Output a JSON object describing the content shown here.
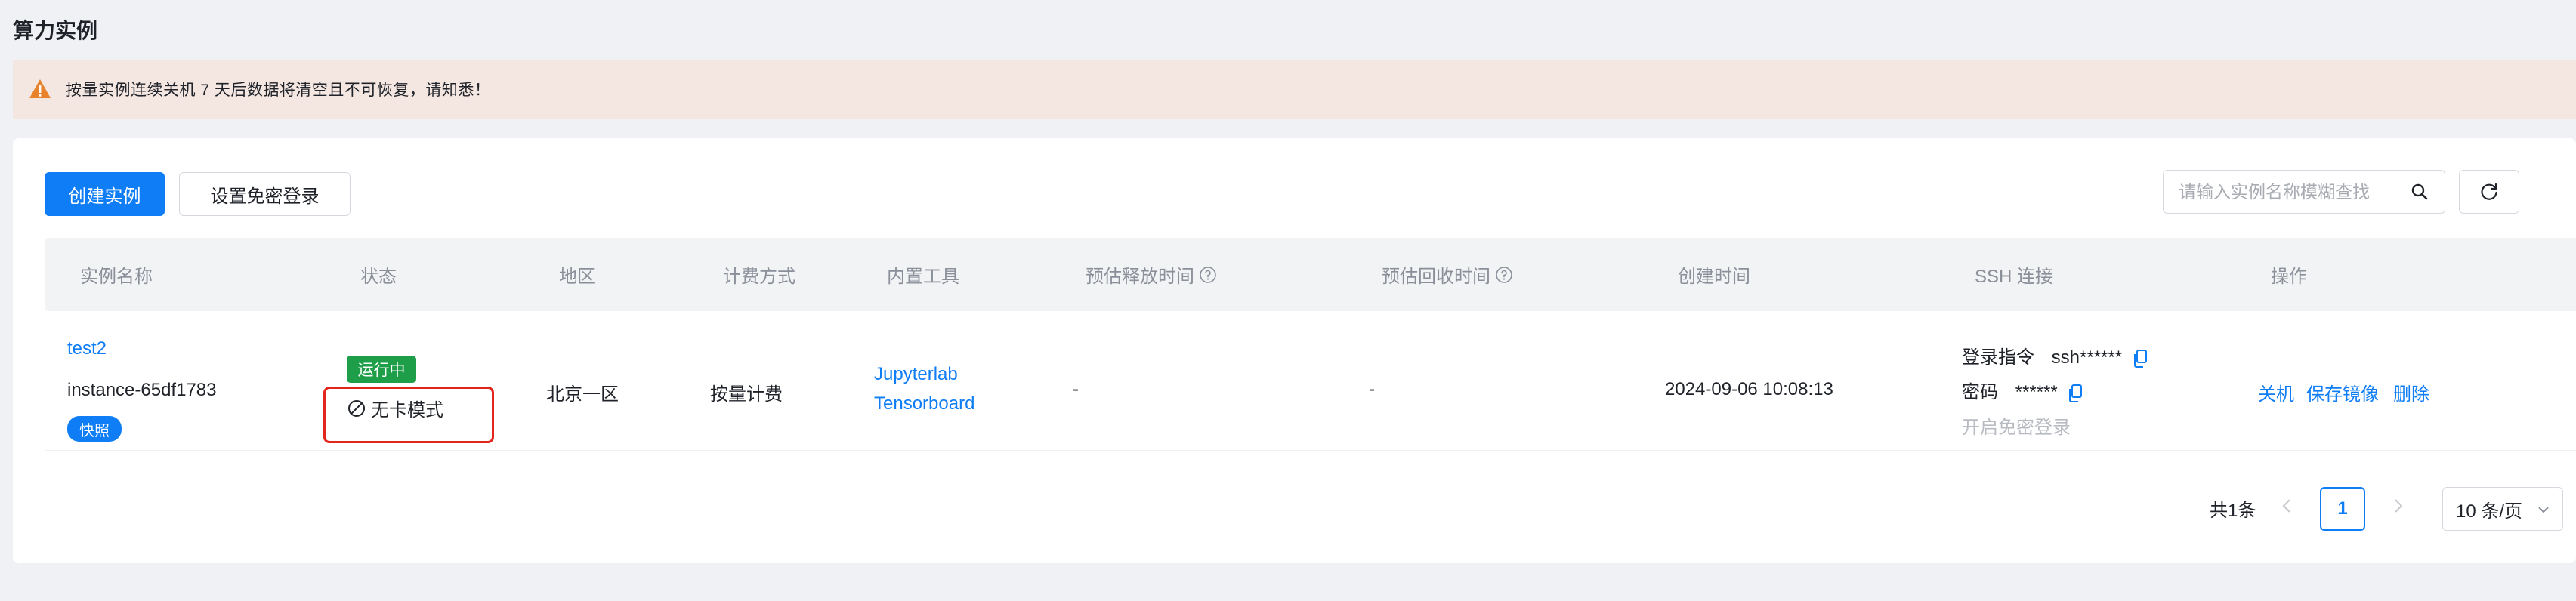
{
  "page": {
    "title": "算力实例"
  },
  "alert": {
    "text": "按量实例连续关机 7 天后数据将清空且不可恢复，请知悉！"
  },
  "toolbar": {
    "create_label": "创建实例",
    "passwordless_label": "设置免密登录",
    "search_placeholder": "请输入实例名称模糊查找"
  },
  "table": {
    "headers": {
      "name": "实例名称",
      "status": "状态",
      "region": "地区",
      "billing": "计费方式",
      "tools": "内置工具",
      "release_time": "预估释放时间",
      "recycle_time": "预估回收时间",
      "created": "创建时间",
      "ssh": "SSH 连接",
      "actions": "操作"
    },
    "rows": [
      {
        "name": "test2",
        "instance_id": "instance-65df1783",
        "snapshot_tag": "快照",
        "status": "运行中",
        "mode": "无卡模式",
        "region": "北京一区",
        "billing": "按量计费",
        "tool_1": "Jupyterlab",
        "tool_2": "Tensorboard",
        "release_time": "-",
        "recycle_time": "-",
        "created": "2024-09-06 10:08:13",
        "ssh_cmd_label": "登录指令",
        "ssh_cmd_value": "ssh******",
        "ssh_pwd_label": "密码",
        "ssh_pwd_value": "******",
        "ssh_passwordless": "开启免密登录",
        "action_shutdown": "关机",
        "action_save_image": "保存镜像",
        "action_delete": "删除"
      }
    ]
  },
  "pagination": {
    "total": "共1条",
    "current_page": "1",
    "page_size": "10 条/页"
  },
  "colors": {
    "primary": "#0e7df6",
    "running": "#1e9e48",
    "alert_bg": "#f4e6e1",
    "warning_icon": "#e8822b",
    "highlight": "#e3261d"
  }
}
